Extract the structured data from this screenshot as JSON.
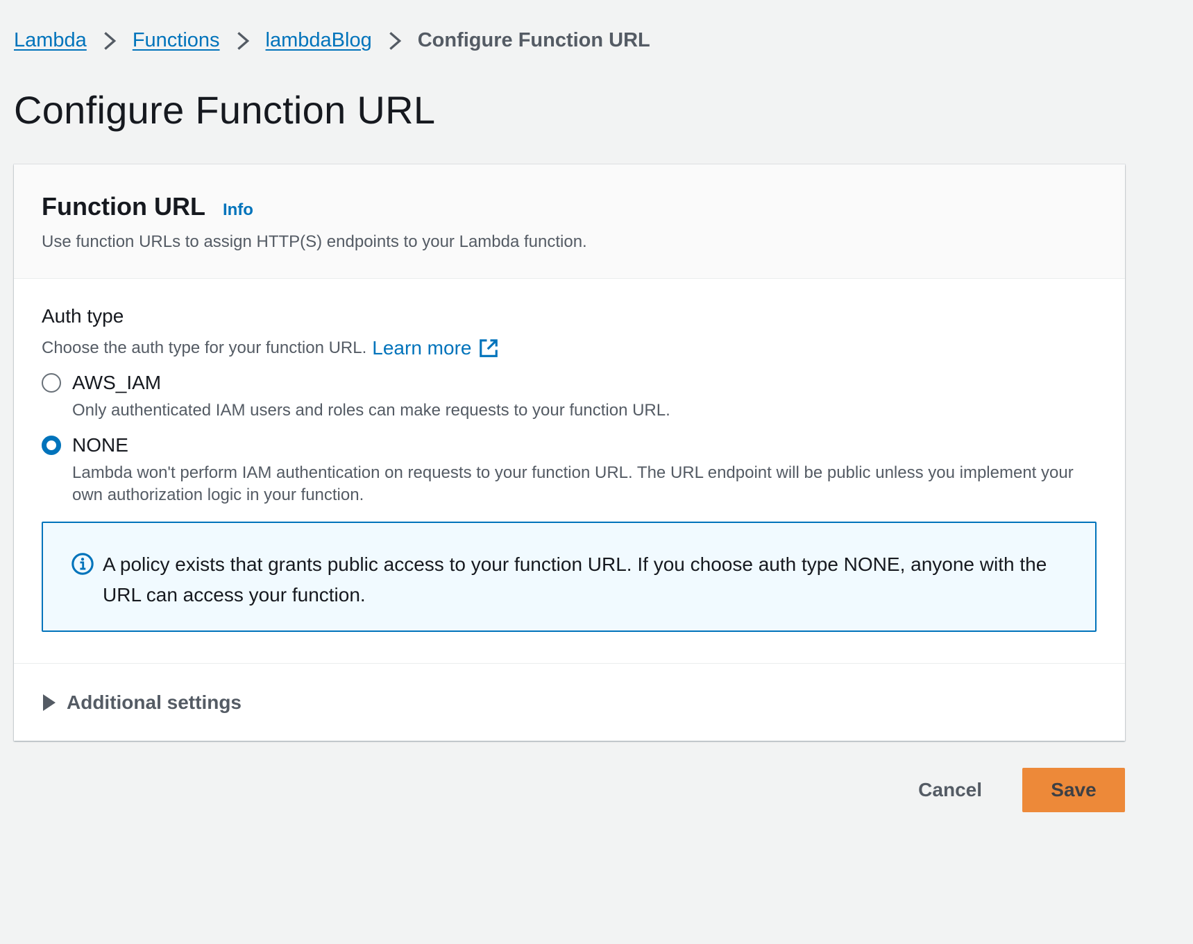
{
  "breadcrumb": {
    "items": [
      "Lambda",
      "Functions",
      "lambdaBlog"
    ],
    "current": "Configure Function URL"
  },
  "page": {
    "title": "Configure Function URL"
  },
  "panel": {
    "title": "Function URL",
    "info": "Info",
    "description": "Use function URLs to assign HTTP(S) endpoints to your Lambda function."
  },
  "auth": {
    "label": "Auth type",
    "description": "Choose the auth type for your function URL.",
    "learn_more": "Learn more",
    "options": [
      {
        "label": "AWS_IAM",
        "description": "Only authenticated IAM users and roles can make requests to your function URL.",
        "selected": false
      },
      {
        "label": "NONE",
        "description": "Lambda won't perform IAM authentication on requests to your function URL. The URL endpoint will be public unless you implement your own authorization logic in your function.",
        "selected": true
      }
    ]
  },
  "alert": {
    "text": "A policy exists that grants public access to your function URL. If you choose auth type NONE, anyone with the URL can access your function."
  },
  "additional": {
    "label": "Additional settings"
  },
  "actions": {
    "cancel": "Cancel",
    "save": "Save"
  },
  "colors": {
    "link": "#0073bb",
    "primary": "#ec7211",
    "background": "#f2f3f3"
  },
  "icons": [
    "chevron-right-icon",
    "external-link-icon",
    "info-circle-icon",
    "caret-right-icon"
  ]
}
